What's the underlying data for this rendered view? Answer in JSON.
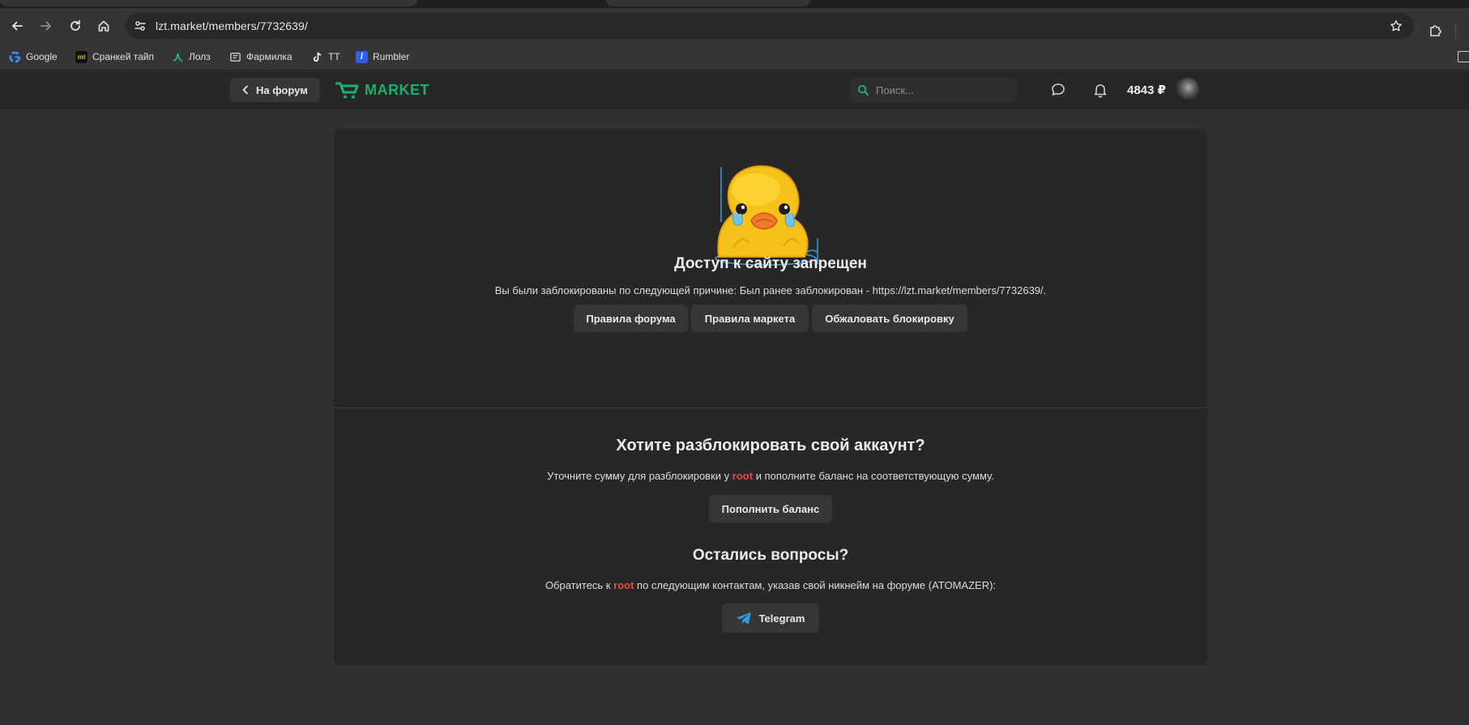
{
  "browser": {
    "url": "lzt.market/members/7732639/",
    "bookmarks": [
      {
        "label": "Google",
        "icon": "google-icon"
      },
      {
        "label": "Сранкей тайп",
        "icon": "monkeytype-icon"
      },
      {
        "label": "Лолз",
        "icon": "lolz-icon"
      },
      {
        "label": "Фармилка",
        "icon": "farmilka-icon"
      },
      {
        "label": "TT",
        "icon": "tiktok-icon"
      },
      {
        "label": "Rumbler",
        "icon": "rambler-icon"
      }
    ]
  },
  "header": {
    "back_label": "На форум",
    "logo_text": "MARKET",
    "search_placeholder": "Поиск...",
    "balance": "4843 ₽",
    "accent_color": "#1eaf6c"
  },
  "ban": {
    "title": "Доступ к сайту запрещен",
    "reason": "Вы были заблокированы по следующей причине: Был ранее заблокирован - https://lzt.market/members/7732639/.",
    "buttons": [
      "Правила форума",
      "Правила маркета",
      "Обжаловать блокировку"
    ]
  },
  "unlock": {
    "title": "Хотите разблокировать свой аккаунт?",
    "text_before": "Уточните сумму для разблокировки у",
    "mention": "root",
    "text_after": "и пополните баланс на соответствующую сумму.",
    "button": "Пополнить баланс"
  },
  "questions": {
    "title": "Остались вопросы?",
    "text_before": "Обратитесь к",
    "mention": "root",
    "text_after": "по следующим контактам, указав свой никнейм на форуме (ATOMAZER):",
    "telegram_label": "Telegram"
  }
}
